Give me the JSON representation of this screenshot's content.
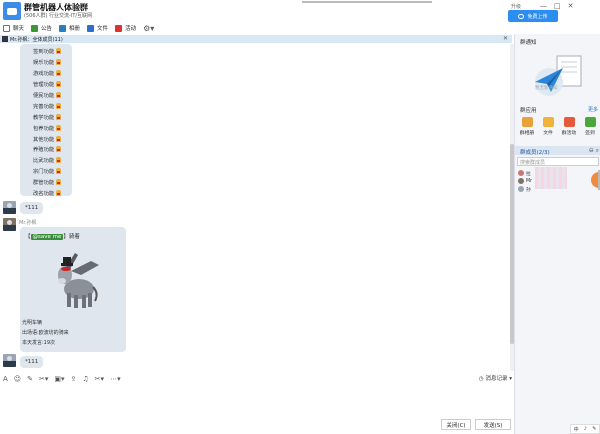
{
  "window": {
    "title": "群管机器人体验群",
    "subtitle": "(506人群) 行业交流-IT/互联网",
    "menu": "升级",
    "upgrade_button": "免费上传"
  },
  "toolbar": {
    "items": [
      {
        "label": "聊天",
        "icon": "chat-icon",
        "color": "#3a7bd5"
      },
      {
        "label": "公告",
        "icon": "announce-icon",
        "color": "#3a9a3a"
      },
      {
        "label": "相册",
        "icon": "album-icon",
        "color": "#2a7fbf"
      },
      {
        "label": "文件",
        "icon": "folder-icon",
        "color": "#2b6fd0"
      },
      {
        "label": "活动",
        "icon": "flag-icon",
        "color": "#d33"
      }
    ]
  },
  "notice": {
    "text": "Mr.孙枫：全体成员(11)",
    "close": "✕"
  },
  "chat": {
    "menu_items": [
      "签到功能",
      "娱乐功能",
      "游戏功能",
      "管理功能",
      "便民功能",
      "完善功能",
      "教学功能",
      "包养功能",
      "其他功能",
      "养殖功能",
      "比武功能",
      "宗门功能",
      "群管功能",
      "改名功能"
    ],
    "reply1": "*111",
    "sender": "Mr.孙枫",
    "card": {
      "mention_bracket_open": "【",
      "mention": "@save me",
      "mention_bracket_close": "】骑着",
      "line1": "光明车辆",
      "line2": "出场语:欧波坊的骑来",
      "line3": "本天发言:19次"
    },
    "reply2": "*111"
  },
  "input": {
    "history": "消息记录",
    "close_button": "关闭(C)",
    "send_button": "发送(S)"
  },
  "sidebar": {
    "notice_title": "群通知",
    "notice_empty": "暂无新通知",
    "apps_title": "群应用",
    "apps_more": "更多",
    "apps": [
      {
        "label": "群相册",
        "color": "#e8a23a"
      },
      {
        "label": "文件",
        "color": "#f0b23a"
      },
      {
        "label": "群活动",
        "color": "#e65a3a"
      },
      {
        "label": "签到",
        "color": "#4aa83a"
      }
    ],
    "members_title": "群成员(2/3)",
    "search_placeholder": "搜索群成员",
    "members": [
      "拉",
      "Mr",
      "孙"
    ]
  },
  "statusbar": {
    "items": [
      "中",
      "♪",
      "✎"
    ]
  }
}
